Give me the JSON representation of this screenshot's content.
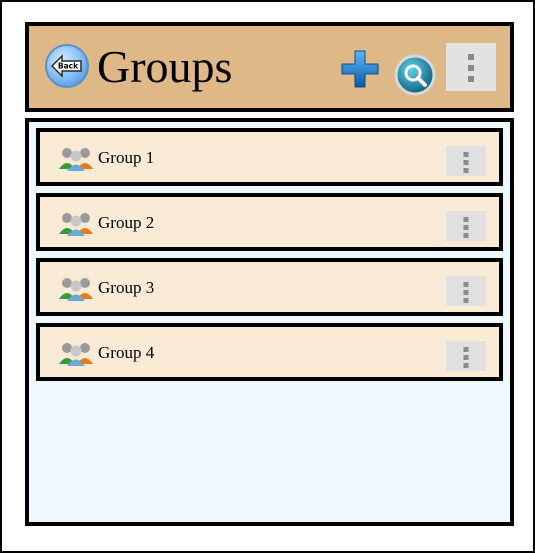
{
  "header": {
    "title": "Groups",
    "back_label": "Back",
    "icons": {
      "back": "back-arrow-icon",
      "add": "plus-icon",
      "search": "magnifier-icon",
      "menu": "overflow-menu-icon"
    },
    "colors": {
      "header_bg": "#deb887",
      "content_bg": "#f0f8ff",
      "item_bg": "#faebd7"
    }
  },
  "groups": {
    "items": [
      {
        "label": "Group 1"
      },
      {
        "label": "Group 2"
      },
      {
        "label": "Group 3"
      },
      {
        "label": "Group 4"
      }
    ]
  }
}
